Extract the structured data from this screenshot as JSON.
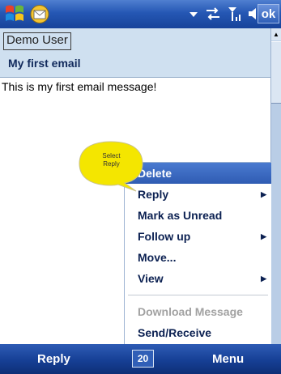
{
  "status_bar": {
    "ok_label": "ok",
    "icons": [
      "start-icon",
      "mail-icon",
      "signal-dropdown-icon",
      "sync-icon",
      "signal-strength-icon",
      "volume-icon"
    ]
  },
  "message": {
    "sender": "Demo User",
    "subject": "My first email",
    "body": "This is my first email message!"
  },
  "callout": {
    "line1": "Select",
    "line2": "Reply"
  },
  "context_menu": {
    "items": [
      {
        "label": "Delete",
        "selected": true,
        "has_submenu": false,
        "enabled": true
      },
      {
        "label": "Reply",
        "selected": false,
        "has_submenu": true,
        "enabled": true
      },
      {
        "label": "Mark as Unread",
        "selected": false,
        "has_submenu": false,
        "enabled": true
      },
      {
        "label": "Follow up",
        "selected": false,
        "has_submenu": true,
        "enabled": true
      },
      {
        "label": "Move...",
        "selected": false,
        "has_submenu": false,
        "enabled": true
      },
      {
        "label": "View",
        "selected": false,
        "has_submenu": true,
        "enabled": true
      },
      {
        "label": "Download Message",
        "selected": false,
        "has_submenu": false,
        "enabled": false
      },
      {
        "label": "Send/Receive",
        "selected": false,
        "has_submenu": false,
        "enabled": true
      }
    ]
  },
  "softkeys": {
    "left": "Reply",
    "right": "Menu",
    "sip": "20"
  },
  "colors": {
    "title_bar": "#2557b4",
    "header_bg": "#cfe0f0",
    "menu_selected": "#3a68c0",
    "callout": "#f4e600"
  }
}
